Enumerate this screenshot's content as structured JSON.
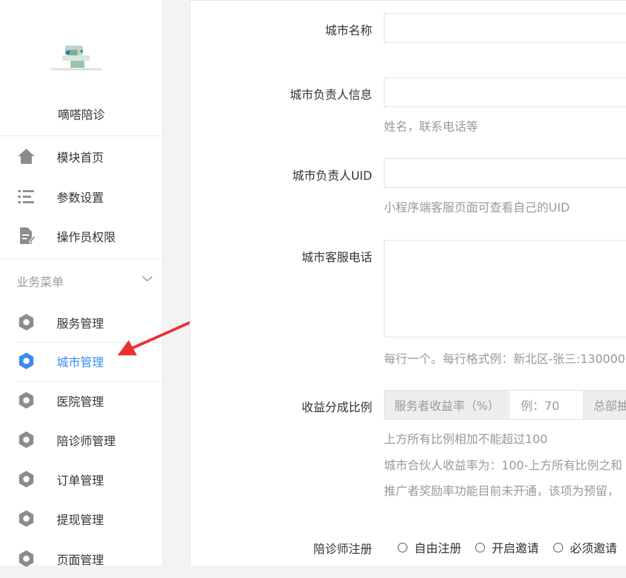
{
  "sidebar": {
    "app_name": "嘀嗒陪诊",
    "top_items": [
      {
        "label": "模块首页",
        "icon": "home-icon"
      },
      {
        "label": "参数设置",
        "icon": "list-settings-icon"
      },
      {
        "label": "操作员权限",
        "icon": "document-edit-icon"
      }
    ],
    "group_title": "业务菜单",
    "group_items": [
      {
        "label": "服务管理",
        "icon": "gear-icon",
        "active": false
      },
      {
        "label": "城市管理",
        "icon": "gear-icon",
        "active": true
      },
      {
        "label": "医院管理",
        "icon": "gear-icon",
        "active": false
      },
      {
        "label": "陪诊师管理",
        "icon": "gear-icon",
        "active": false
      },
      {
        "label": "订单管理",
        "icon": "gear-icon",
        "active": false
      },
      {
        "label": "提现管理",
        "icon": "gear-icon",
        "active": false
      },
      {
        "label": "页面管理",
        "icon": "gear-icon",
        "active": false
      }
    ],
    "active_color": "#3b8cf0"
  },
  "form": {
    "city_name": {
      "label": "城市名称",
      "value": ""
    },
    "leader_info": {
      "label": "城市负责人信息",
      "value": "",
      "hint": "姓名，联系电话等"
    },
    "leader_uid": {
      "label": "城市负责人UID",
      "value": "",
      "hint": "小程序端客服页面可查看自己的UID"
    },
    "service_phone": {
      "label": "城市客服电话",
      "value": "",
      "hint": "每行一个。每行格式例：新北区-张三:130000"
    },
    "revenue_share": {
      "label": "收益分成比例",
      "addon_left": "服务者收益率（%）",
      "placeholder": "例：70",
      "addon_right": "总部抽",
      "hints": [
        "上方所有比例相加不能超过100",
        "城市合伙人收益率为：100-上方所有比例之和",
        "推广者奖励率功能目前未开通，该项为预留，"
      ]
    },
    "registration": {
      "label": "陪诊师注册",
      "options": [
        "自由注册",
        "开启邀请",
        "必须邀请"
      ]
    }
  }
}
